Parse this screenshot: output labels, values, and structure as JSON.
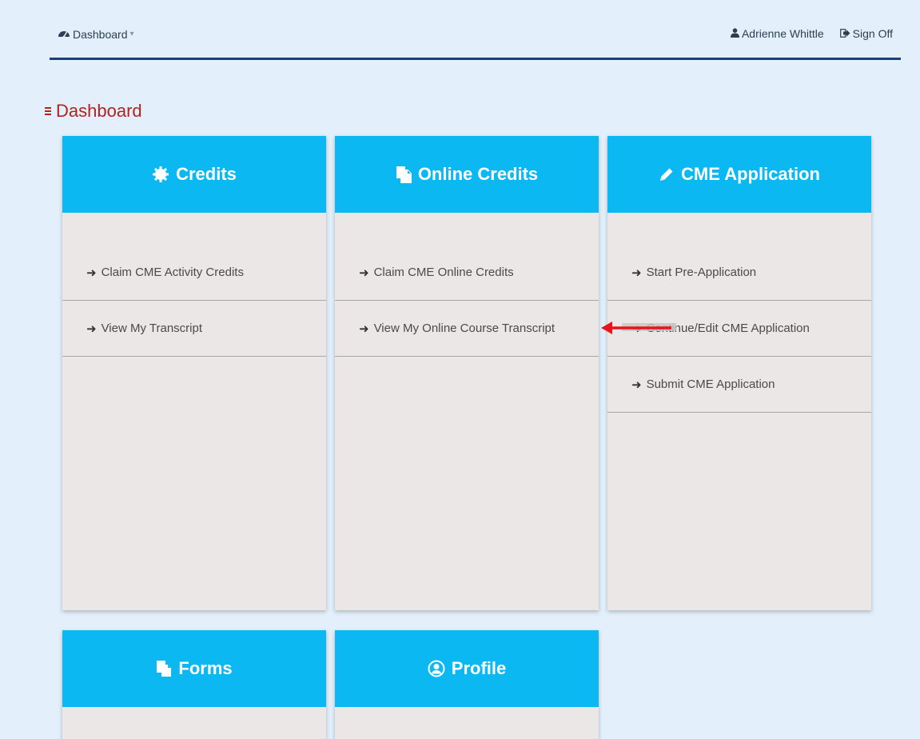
{
  "nav": {
    "dashboard_label": "Dashboard",
    "user_name": "Adrienne Whittle",
    "signoff_label": "Sign Off"
  },
  "page": {
    "title": "Dashboard"
  },
  "tiles": [
    {
      "title": "Credits",
      "icon": "gear-icon",
      "links": [
        "Claim CME Activity Credits",
        "View My Transcript"
      ]
    },
    {
      "title": "Online Credits",
      "icon": "copy-icon",
      "links": [
        "Claim CME Online Credits",
        "View My Online Course Transcript"
      ]
    },
    {
      "title": "CME Application",
      "icon": "pencil-icon",
      "links": [
        "Start Pre-Application",
        "Continue/Edit CME Application",
        "Submit CME Application"
      ]
    },
    {
      "title": "Forms",
      "icon": "copy-icon",
      "links": []
    },
    {
      "title": "Profile",
      "icon": "user-circle-icon",
      "links": []
    }
  ],
  "colors": {
    "background": "#e3f0fb",
    "tile_header": "#0bb8f2",
    "tile_body": "#ebe7e7",
    "nav_rule": "#1c3f78",
    "title_red": "#b22222",
    "annotation_arrow": "#e8141c"
  }
}
